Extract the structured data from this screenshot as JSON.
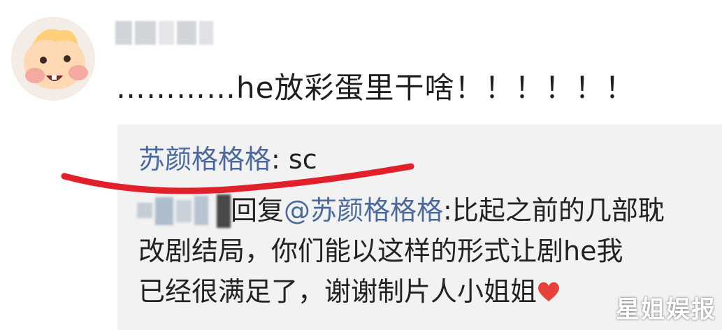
{
  "comment": {
    "text": "…………he放彩蛋里干啥！！！！！！"
  },
  "reply": {
    "author": "苏颜格格格",
    "separator": ": ",
    "text": "sc"
  },
  "nested_reply": {
    "reply_word": "回复",
    "mention": "@苏颜格格格",
    "line1_text": ":比起之前的几部耽",
    "line2_text": "改剧结局，你们能以这样的形式让剧he我",
    "line3_text": "已经很满足了，谢谢制片人小姐姐"
  },
  "watermark": {
    "text": "星姐娱报"
  },
  "colors": {
    "mention_blue": "#4a6a9e",
    "reply_bg": "#f2f2f2",
    "underline_red": "#e0212b",
    "heart_red": "#e8413a"
  },
  "icons": [
    "avatar-icon",
    "heart-icon"
  ]
}
